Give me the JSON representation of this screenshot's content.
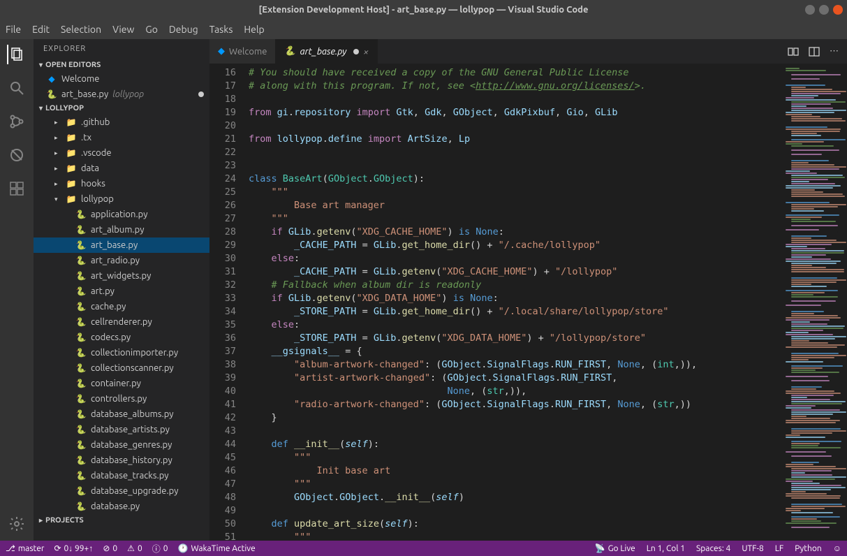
{
  "titlebar": "[Extension Development Host] - art_base.py — lollypop — Visual Studio Code",
  "menu": [
    "File",
    "Edit",
    "Selection",
    "View",
    "Go",
    "Debug",
    "Tasks",
    "Help"
  ],
  "sidebar_title": "EXPLORER",
  "sections": {
    "open_editors": "OPEN EDITORS",
    "workspace": "LOLLYPOP",
    "projects": "PROJECTS"
  },
  "open_editors": [
    {
      "label": "Welcome",
      "icon": "vs"
    },
    {
      "label": "art_base.py",
      "icon": "py",
      "desc": "lollypop",
      "modified": true
    }
  ],
  "tree": [
    {
      "label": ".github",
      "kind": "folder-red",
      "indent": 1,
      "chev": "▸"
    },
    {
      "label": ".tx",
      "kind": "folder",
      "indent": 1,
      "chev": "▸"
    },
    {
      "label": ".vscode",
      "kind": "folder",
      "indent": 1,
      "chev": "▸"
    },
    {
      "label": "data",
      "kind": "folder",
      "indent": 1,
      "chev": "▸"
    },
    {
      "label": "hooks",
      "kind": "folder",
      "indent": 1,
      "chev": "▸"
    },
    {
      "label": "lollypop",
      "kind": "folder",
      "indent": 1,
      "chev": "▾"
    },
    {
      "label": "application.py",
      "kind": "py",
      "indent": 2
    },
    {
      "label": "art_album.py",
      "kind": "py",
      "indent": 2
    },
    {
      "label": "art_base.py",
      "kind": "py",
      "indent": 2,
      "selected": true
    },
    {
      "label": "art_radio.py",
      "kind": "py",
      "indent": 2
    },
    {
      "label": "art_widgets.py",
      "kind": "py",
      "indent": 2
    },
    {
      "label": "art.py",
      "kind": "py",
      "indent": 2
    },
    {
      "label": "cache.py",
      "kind": "py",
      "indent": 2
    },
    {
      "label": "cellrenderer.py",
      "kind": "py",
      "indent": 2
    },
    {
      "label": "codecs.py",
      "kind": "py",
      "indent": 2
    },
    {
      "label": "collectionimporter.py",
      "kind": "py",
      "indent": 2
    },
    {
      "label": "collectionscanner.py",
      "kind": "py",
      "indent": 2
    },
    {
      "label": "container.py",
      "kind": "py",
      "indent": 2
    },
    {
      "label": "controllers.py",
      "kind": "py",
      "indent": 2
    },
    {
      "label": "database_albums.py",
      "kind": "py",
      "indent": 2
    },
    {
      "label": "database_artists.py",
      "kind": "py",
      "indent": 2
    },
    {
      "label": "database_genres.py",
      "kind": "py",
      "indent": 2
    },
    {
      "label": "database_history.py",
      "kind": "py",
      "indent": 2
    },
    {
      "label": "database_tracks.py",
      "kind": "py",
      "indent": 2
    },
    {
      "label": "database_upgrade.py",
      "kind": "py",
      "indent": 2
    },
    {
      "label": "database.py",
      "kind": "py",
      "indent": 2
    }
  ],
  "tabs": [
    {
      "label": "Welcome",
      "icon": "vs",
      "active": false
    },
    {
      "label": "art_base.py",
      "icon": "py",
      "active": true,
      "modified": true
    }
  ],
  "line_numbers": [
    16,
    17,
    18,
    19,
    20,
    21,
    22,
    23,
    24,
    25,
    26,
    27,
    28,
    29,
    30,
    31,
    32,
    33,
    34,
    35,
    36,
    37,
    38,
    39,
    40,
    41,
    42,
    43,
    44,
    45,
    46,
    47,
    48,
    49,
    50,
    51
  ],
  "code_url": "http://www.gnu.org/licenses/",
  "statusbar": {
    "branch": "master",
    "sync": "0↓ 99+↑",
    "errors": "0",
    "warnings": "0",
    "port_fail": "0",
    "wakatime": "WakaTime Active",
    "golive": "Go Live",
    "position": "Ln 1, Col 1",
    "spaces": "Spaces: 4",
    "encoding": "UTF-8",
    "eol": "LF",
    "lang": "Python"
  }
}
